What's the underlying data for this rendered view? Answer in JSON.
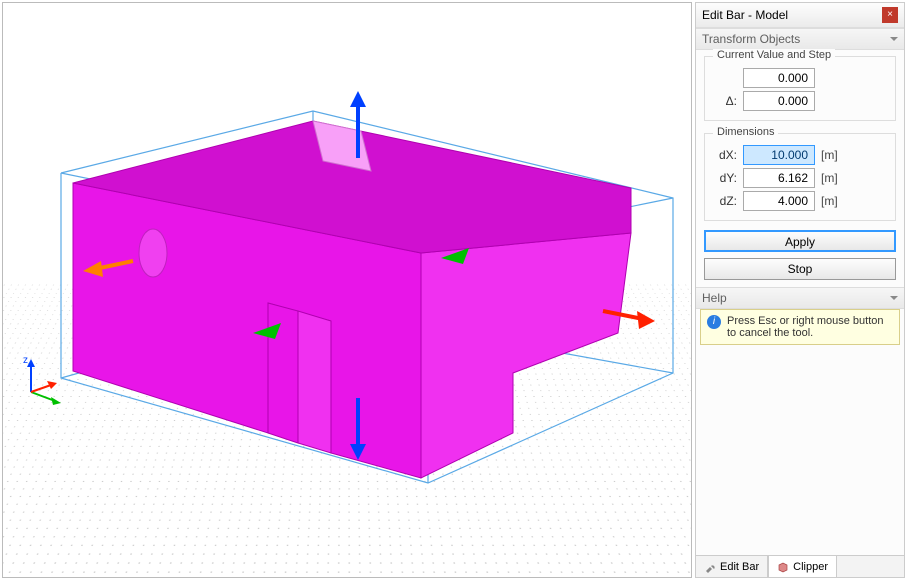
{
  "panel": {
    "title": "Edit Bar - Model",
    "transform_header": "Transform Objects",
    "current_group": "Current Value and Step",
    "delta_label": "Δ:",
    "current_value": "0.000",
    "step_value": "0.000",
    "dimensions_group": "Dimensions",
    "dx_label": "dX:",
    "dy_label": "dY:",
    "dz_label": "dZ:",
    "dx_value": "10.000",
    "dy_value": "6.162",
    "dz_value": "4.000",
    "unit": "[m]",
    "apply": "Apply",
    "stop": "Stop",
    "help_header": "Help",
    "help_text": "Press Esc or right mouse button to cancel the tool."
  },
  "tabs": {
    "edit_bar": "Edit Bar",
    "clipper": "Clipper"
  },
  "axis": {
    "z": "z"
  }
}
